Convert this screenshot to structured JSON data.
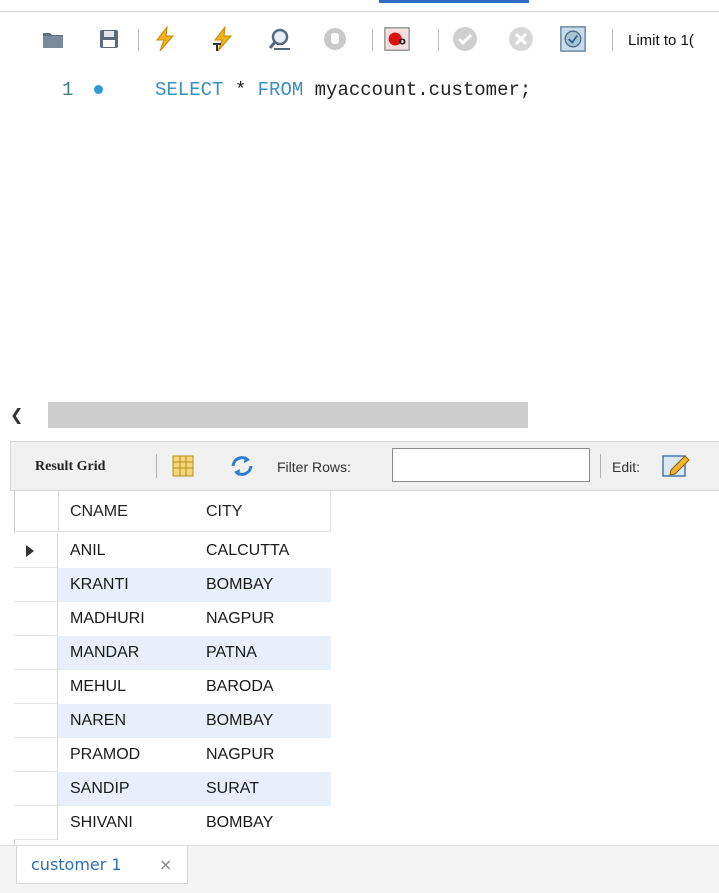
{
  "toolbar": {
    "limit_label": "Limit to 1(",
    "icons": [
      "open-folder-icon",
      "save-icon",
      "execute-icon",
      "execute-current-icon",
      "explain-icon",
      "stop-icon",
      "toggle-error-icon",
      "commit-icon",
      "rollback-icon",
      "autocommit-icon"
    ]
  },
  "editor": {
    "line_number": "1",
    "keyword_select": "SELECT",
    "star": "*",
    "keyword_from": "FROM",
    "table_ref": "myaccount.customer;"
  },
  "result_toolbar": {
    "result_grid_label": "Result Grid",
    "filter_rows_label": "Filter Rows:",
    "filter_value": "",
    "edit_label": "Edit:"
  },
  "grid": {
    "columns": [
      "CNAME",
      "CITY"
    ],
    "rows": [
      [
        "ANIL",
        "CALCUTTA"
      ],
      [
        "KRANTI",
        "BOMBAY"
      ],
      [
        "MADHURI",
        "NAGPUR"
      ],
      [
        "MANDAR",
        "PATNA"
      ],
      [
        "MEHUL",
        "BARODA"
      ],
      [
        "NAREN",
        "BOMBAY"
      ],
      [
        "PRAMOD",
        "NAGPUR"
      ],
      [
        "SANDIP",
        "SURAT"
      ],
      [
        "SHIVANI",
        "BOMBAY"
      ]
    ]
  },
  "bottom_tab": {
    "label": "customer 1",
    "close": "×"
  },
  "colors": {
    "keyword": "#3a8ec0",
    "selected_row_alt": "#e8eefa",
    "tab_label": "#2b6fb0"
  }
}
